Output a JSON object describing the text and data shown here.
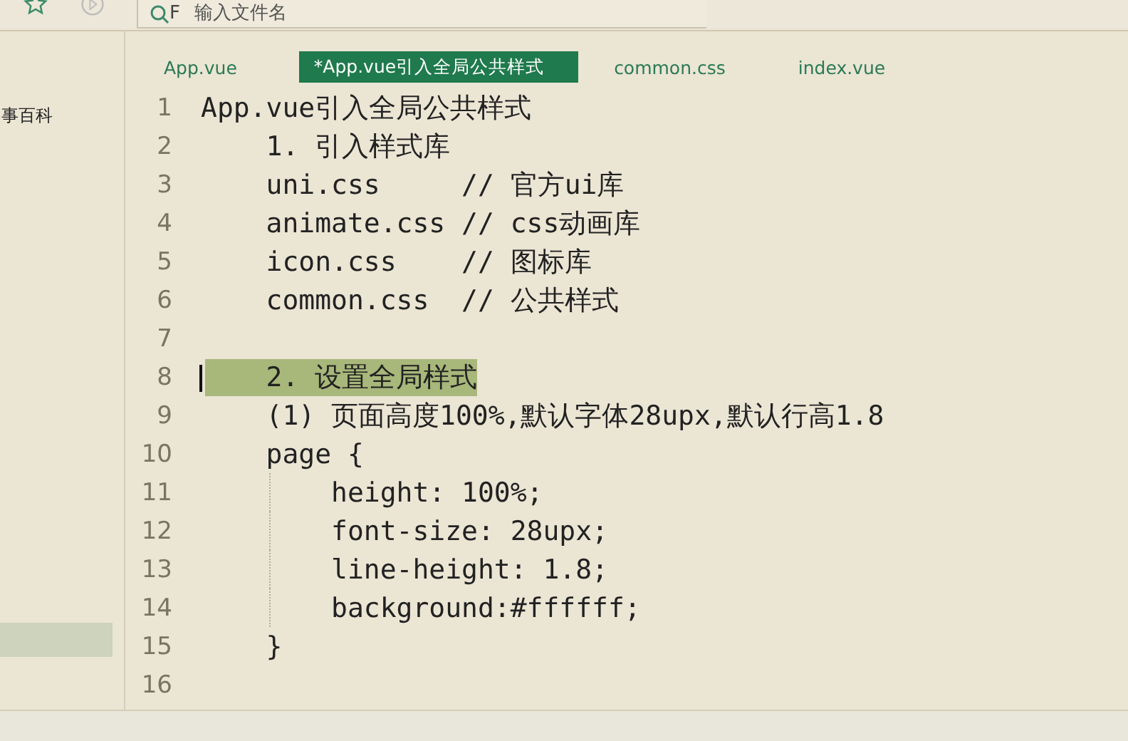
{
  "toolbar": {
    "search": {
      "prefix": "F",
      "placeholder": "输入文件名"
    }
  },
  "sidebar": {
    "items": [
      {
        "label": "事百科",
        "selected": false
      },
      {
        "selected": true
      }
    ]
  },
  "tabs": [
    {
      "label": "App.vue",
      "selected": false
    },
    {
      "label": "*App.vue引入全局公共样式",
      "selected": true
    },
    {
      "label": "common.css",
      "selected": false
    },
    {
      "label": "index.vue",
      "selected": false
    }
  ],
  "editor": {
    "lines": [
      {
        "number": "1",
        "text": "App.vue引入全局公共样式",
        "selected": false
      },
      {
        "number": "2",
        "text": "    1. 引入样式库",
        "selected": false
      },
      {
        "number": "3",
        "text": "    uni.css     // 官方ui库",
        "selected": false
      },
      {
        "number": "4",
        "text": "    animate.css // css动画库",
        "selected": false
      },
      {
        "number": "5",
        "text": "    icon.css    // 图标库",
        "selected": false
      },
      {
        "number": "6",
        "text": "    common.css  // 公共样式",
        "selected": false
      },
      {
        "number": "7",
        "selected": false
      },
      {
        "number": "8",
        "text": "    2. 设置全局样式",
        "selected": true
      },
      {
        "number": "9",
        "text": "    (1) 页面高度100%,默认字体28upx,默认行高1.8",
        "selected": false
      },
      {
        "number": "10",
        "text": "    page {",
        "selected": false
      },
      {
        "number": "11",
        "text": "        height: 100%;",
        "selected": false
      },
      {
        "number": "12",
        "text": "        font-size: 28upx;",
        "selected": false
      },
      {
        "number": "13",
        "text": "        line-height: 1.8;",
        "selected": false
      },
      {
        "number": "14",
        "text": "        background:#ffffff;",
        "selected": false
      },
      {
        "number": "15",
        "text": "    }",
        "selected": false
      },
      {
        "number": "16",
        "selected": false
      }
    ]
  }
}
